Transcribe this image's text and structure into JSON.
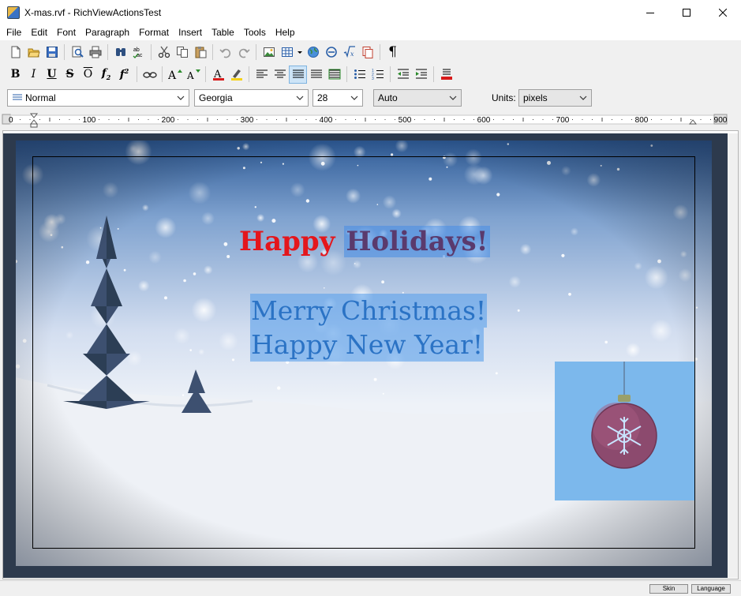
{
  "window": {
    "title": "X-mas.rvf - RichViewActionsTest",
    "icon": "richview-app-icon"
  },
  "menu": [
    "File",
    "Edit",
    "Font",
    "Paragraph",
    "Format",
    "Insert",
    "Table",
    "Tools",
    "Help"
  ],
  "format_bar": {
    "style": "Normal",
    "font": "Georgia",
    "size": "28",
    "color_mode": "Auto",
    "units_label": "Units:",
    "units_value": "pixels"
  },
  "ruler": {
    "labels": [
      "0",
      "100",
      "200",
      "300",
      "400",
      "500",
      "600",
      "700",
      "800",
      "900"
    ]
  },
  "document": {
    "heading_part1": "Happy",
    "heading_part2": "Holidays!",
    "line1": "Merry Christmas!",
    "line2": "Happy New Year!",
    "colors": {
      "heading_red": "#e4161c",
      "body_blue": "#2b73c5",
      "selection": "#7cb8ec"
    }
  },
  "statusbar": {
    "skin_button": "Skin",
    "language_button": "Language"
  }
}
